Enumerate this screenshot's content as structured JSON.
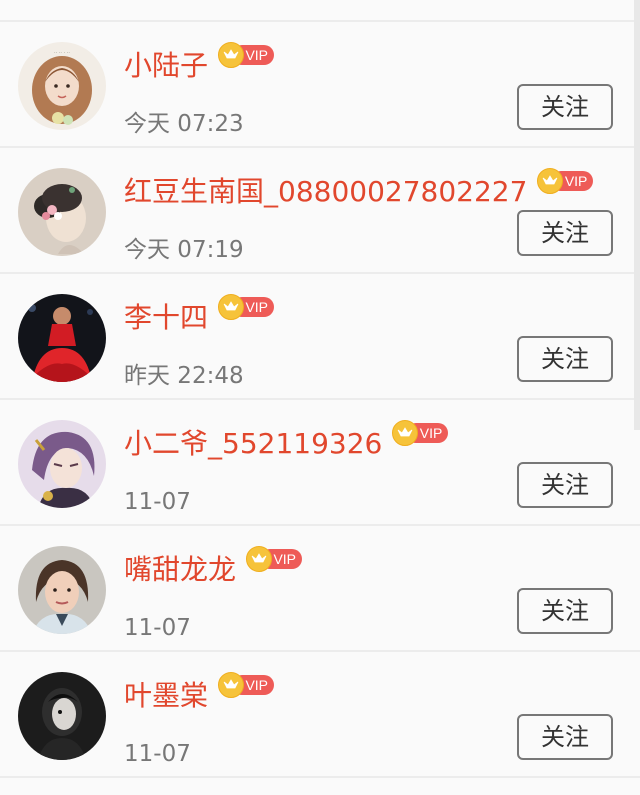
{
  "list": {
    "items": [
      {
        "name": "小陆子",
        "vip_label": "VIP",
        "time": "今天 07:23",
        "follow_label": "关注"
      },
      {
        "name": "红豆生南国_08800027802227",
        "vip_label": "VIP",
        "time": "今天 07:19",
        "follow_label": "关注"
      },
      {
        "name": "李十四",
        "vip_label": "VIP",
        "time": "昨天 22:48",
        "follow_label": "关注"
      },
      {
        "name": "小二爷_552119326",
        "vip_label": "VIP",
        "time": "11-07",
        "follow_label": "关注"
      },
      {
        "name": "嘴甜龙龙",
        "vip_label": "VIP",
        "time": "11-07",
        "follow_label": "关注"
      },
      {
        "name": "叶墨棠",
        "vip_label": "VIP",
        "time": "11-07",
        "follow_label": "关注"
      }
    ]
  },
  "colors": {
    "name_color": "#e1472d",
    "vip_tag": "#ee5b57",
    "crown": "#f6c33a",
    "time_color": "#777777"
  },
  "icons": {
    "vip_badge": "crown-vip-icon"
  }
}
